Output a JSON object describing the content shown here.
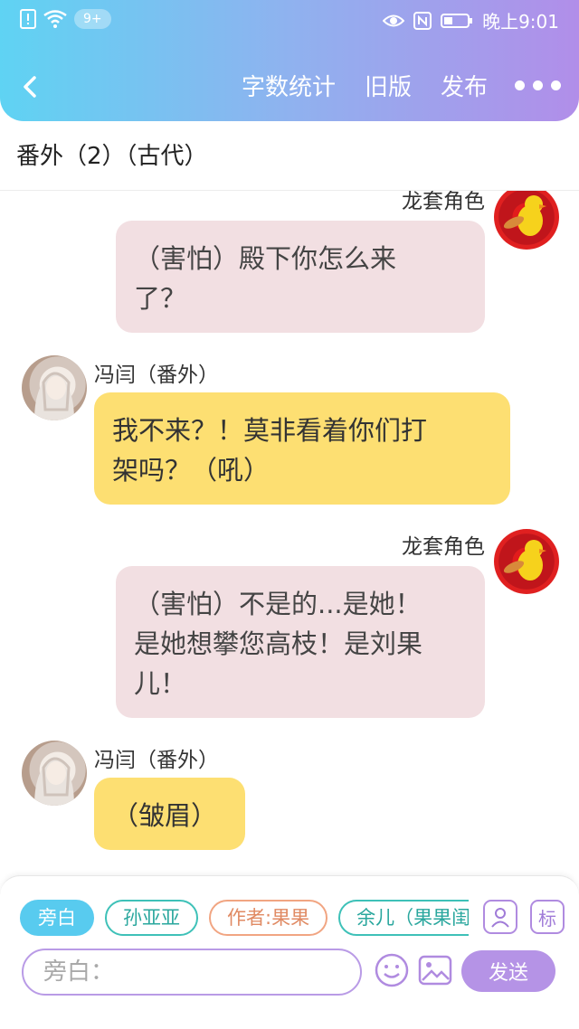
{
  "status_bar": {
    "badge": "9+",
    "time": "晚上9:01"
  },
  "nav": {
    "word_count": "字数统计",
    "old_version": "旧版",
    "publish": "发布"
  },
  "doc": {
    "title": "番外（2）（古代）"
  },
  "messages": [
    {
      "name": "龙套角色",
      "text_lines": [
        "（害怕）殿下你怎么来",
        "了？"
      ]
    },
    {
      "name": "冯闫（番外）",
      "text_lines": [
        "我不来？！莫非看着你们打",
        "架吗？（吼）"
      ]
    },
    {
      "name": "龙套角色",
      "text_lines": [
        "（害怕）不是的...是她！",
        "是她想攀您高枝！是刘果",
        "儿！"
      ]
    },
    {
      "name": "冯闫（番外）",
      "text_lines": [
        "（皱眉）"
      ]
    }
  ],
  "composer": {
    "roles": [
      "旁白",
      "孙亚亚",
      "作者:果果",
      "余儿（果果闺"
    ],
    "mark_label": "标",
    "input_placeholder": "旁白：",
    "send_label": "发送"
  },
  "colors": {
    "header_start": "#5fd3f3",
    "header_end": "#b18ee9",
    "pink_bubble": "#f2dfe2",
    "yellow_bubble": "#fddf72",
    "send": "#b593e6"
  }
}
